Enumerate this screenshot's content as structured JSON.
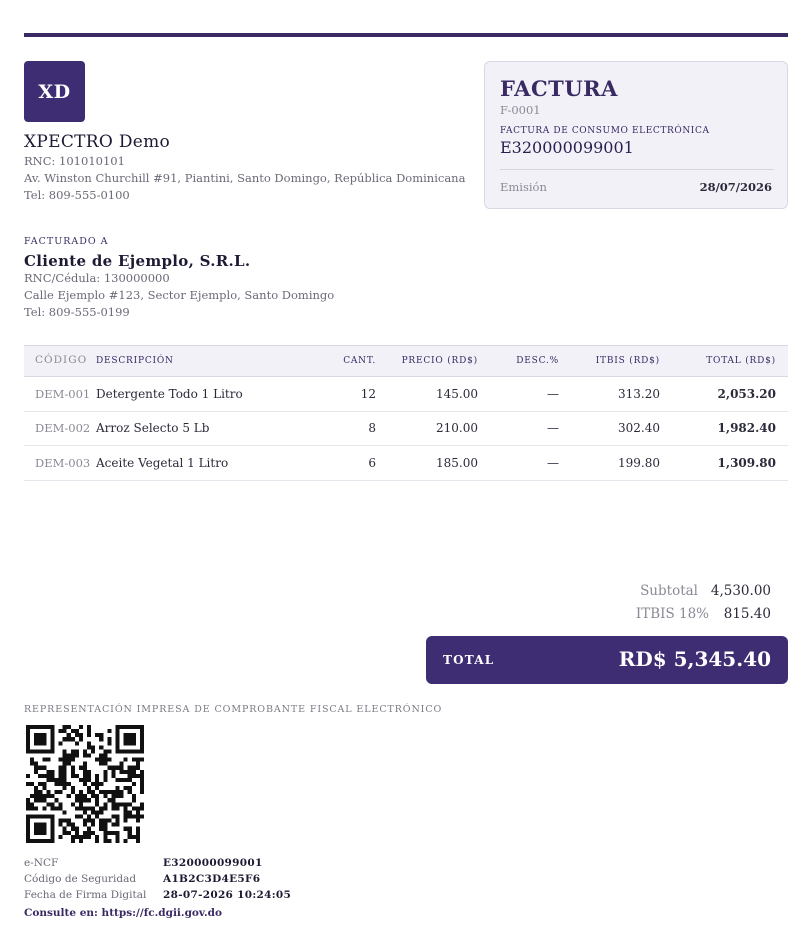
{
  "company": {
    "logo_text": "XD",
    "name": "XPECTRO Demo",
    "rnc": "RNC: 101010101",
    "address": "Av. Winston Churchill #91, Piantini, Santo Domingo, República Dominicana",
    "phone": "Tel: 809-555-0100"
  },
  "invoice": {
    "title": "FACTURA",
    "number": "F-0001",
    "type": "FACTURA DE CONSUMO ELECTRÓNICA",
    "encf": "E320000099001",
    "issue_label": "Emisión",
    "issue_date": "28/07/2026"
  },
  "client": {
    "label": "FACTURADO A",
    "name": "Cliente de Ejemplo, S.R.L.",
    "rnc": "RNC/Cédula: 130000000",
    "address": "Calle Ejemplo #123, Sector Ejemplo, Santo Domingo",
    "phone": "Tel: 809-555-0199"
  },
  "table": {
    "headers": [
      "CÓDIGO",
      "DESCRIPCIÓN",
      "CANT.",
      "PRECIO (RD$)",
      "DESC.%",
      "ITBIS (RD$)",
      "TOTAL (RD$)"
    ],
    "rows": [
      {
        "code": "DEM-001",
        "description": "Detergente Todo 1 Litro",
        "qty": "12",
        "price": "145.00",
        "disc": "—",
        "itbis": "313.20",
        "total": "2,053.20"
      },
      {
        "code": "DEM-002",
        "description": "Arroz Selecto 5 Lb",
        "qty": "8",
        "price": "210.00",
        "disc": "—",
        "itbis": "302.40",
        "total": "1,982.40"
      },
      {
        "code": "DEM-003",
        "description": "Aceite Vegetal 1 Litro",
        "qty": "6",
        "price": "185.00",
        "disc": "—",
        "itbis": "199.80",
        "total": "1,309.80"
      }
    ]
  },
  "summary": {
    "subtotal_label": "Subtotal",
    "subtotal": "4,530.00",
    "itbis_label": "ITBIS 18%",
    "itbis": "815.40",
    "total_label": "TOTAL",
    "total": "RD$ 5,345.40"
  },
  "fiscal": {
    "representation": "REPRESENTACIÓN IMPRESA DE COMPROBANTE FISCAL ELECTRÓNICO",
    "encf_label": "e-NCF",
    "encf": "E320000099001",
    "security_label": "Código de Seguridad",
    "security_code": "A1B2C3D4E5F6",
    "sign_label": "Fecha de Firma Digital",
    "sign_date": "28-07-2026 10:24:05",
    "consult": "Consulte en: https://fc.dgii.gov.do"
  },
  "colors": {
    "brand": "#3e2d72",
    "panel": "#f2f1f7"
  },
  "icons": {
    "qr": "qr-code-icon"
  }
}
